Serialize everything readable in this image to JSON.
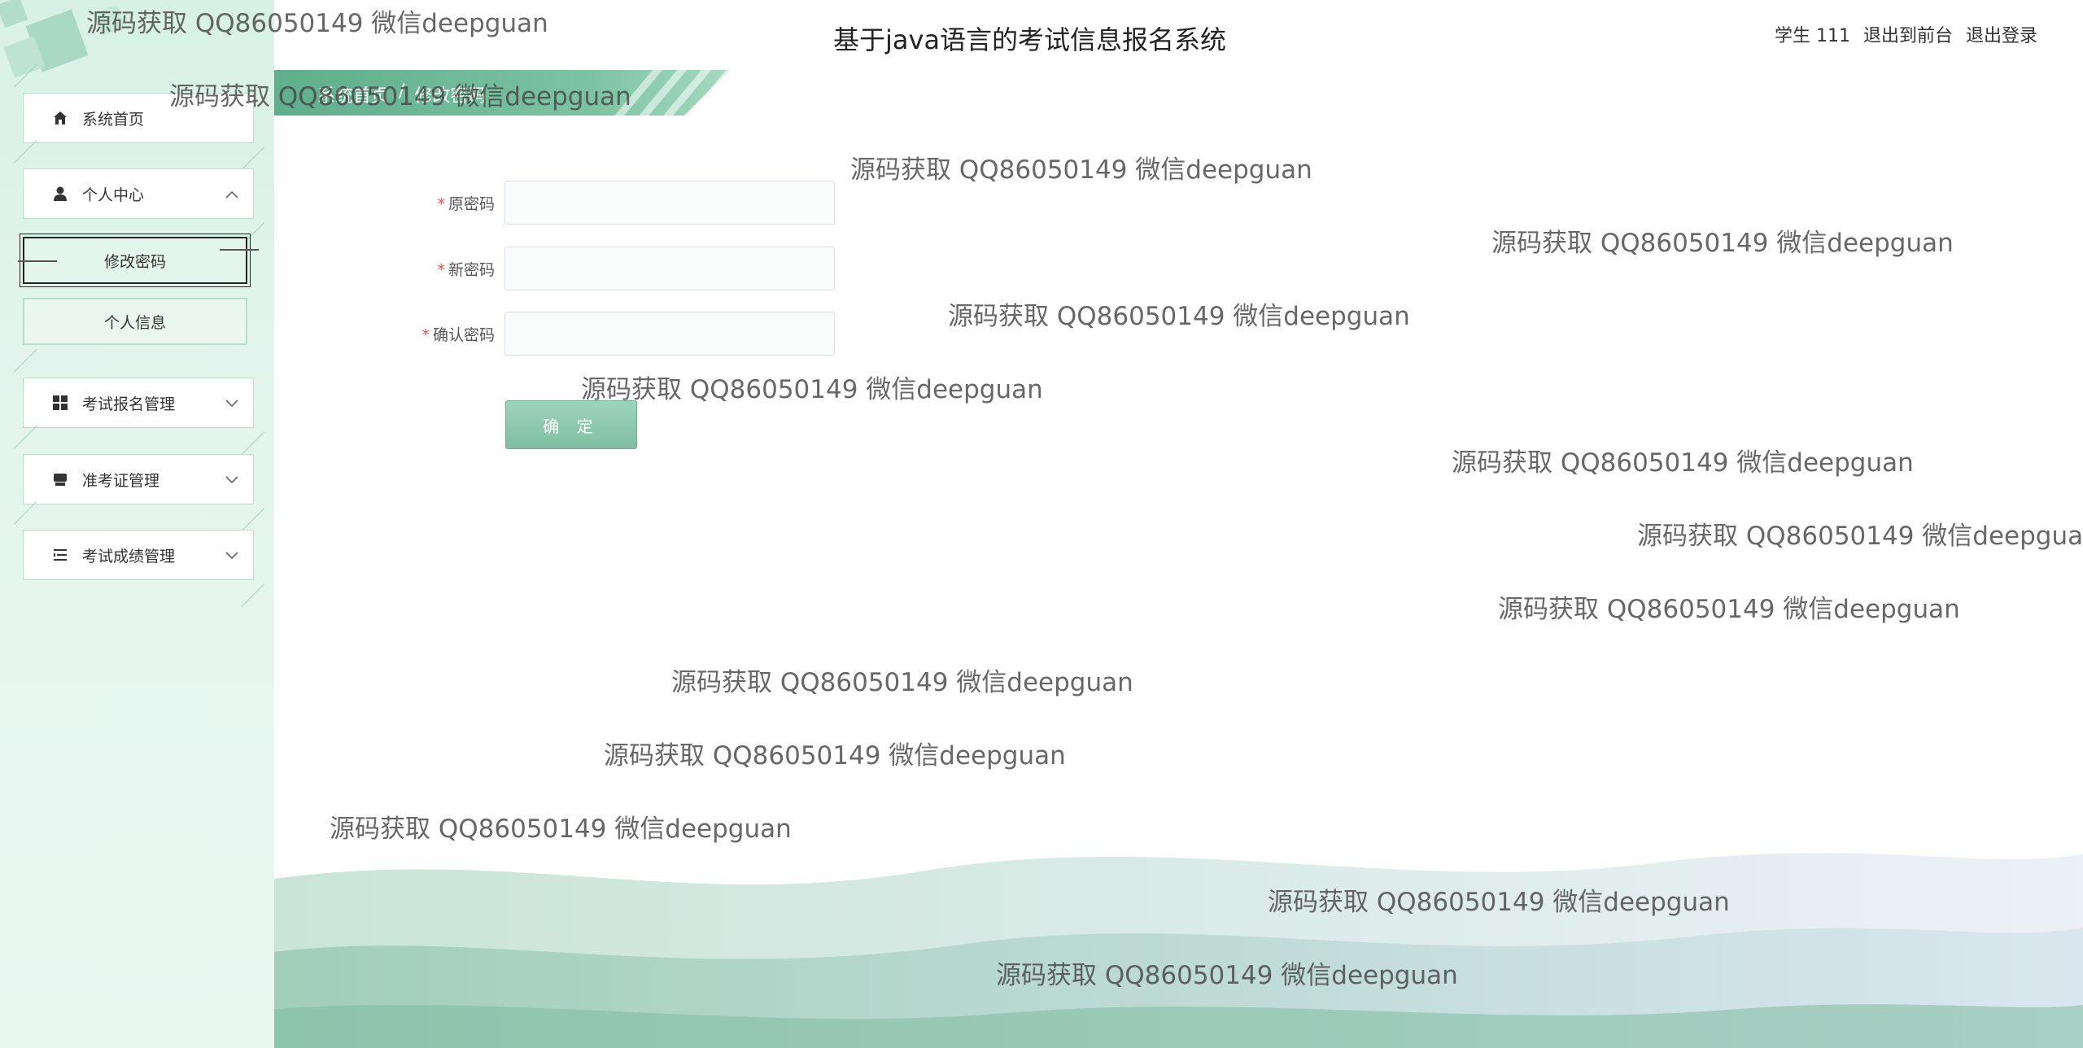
{
  "header": {
    "title": "基于java语言的考试信息报名系统",
    "user_label": "学生 111",
    "to_front": "退出到前台",
    "logout": "退出登录"
  },
  "breadcrumb": {
    "home": "系统首页",
    "separator": "/",
    "current": "修改密码"
  },
  "sidebar": {
    "items": [
      {
        "label": "系统首页",
        "icon": "home-icon"
      },
      {
        "label": "个人中心",
        "icon": "user-icon",
        "expanded": true
      },
      {
        "label": "考试报名管理",
        "icon": "grid-icon"
      },
      {
        "label": "准考证管理",
        "icon": "card-icon"
      },
      {
        "label": "考试成绩管理",
        "icon": "list-icon"
      }
    ],
    "sub_items": [
      {
        "label": "修改密码",
        "active": true
      },
      {
        "label": "个人信息",
        "active": false
      }
    ]
  },
  "form": {
    "old_password_label": "原密码",
    "new_password_label": "新密码",
    "confirm_password_label": "确认密码",
    "required_mark": "*",
    "old_password_value": "",
    "new_password_value": "",
    "confirm_password_value": "",
    "submit_label": "确 定"
  },
  "watermark": {
    "text": "源码获取 QQ86050149 微信deepguan"
  },
  "colors": {
    "accent": "#7cc3a2",
    "sidebar_bg": "#d8f1e6",
    "required": "#e05252"
  }
}
